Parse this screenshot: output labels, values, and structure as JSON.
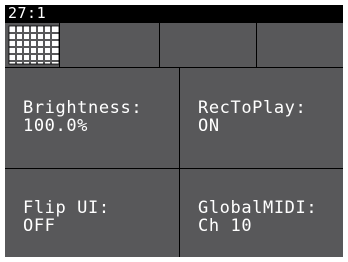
{
  "status": {
    "text": "27:1"
  },
  "tabs": [
    {
      "icon": "grid-icon"
    },
    {
      "label": ""
    },
    {
      "label": ""
    },
    {
      "label": ""
    }
  ],
  "params": [
    {
      "label": "Brightness:",
      "value": "100.0%"
    },
    {
      "label": "RecToPlay:",
      "value": "ON"
    },
    {
      "label": "Flip UI:",
      "value": "OFF"
    },
    {
      "label": "GlobalMIDI:",
      "value": "Ch 10"
    }
  ],
  "colors": {
    "screen_bg": "#58585a",
    "status_bg": "#000000",
    "text": "#ffffff",
    "grid_lines": "#000000"
  }
}
